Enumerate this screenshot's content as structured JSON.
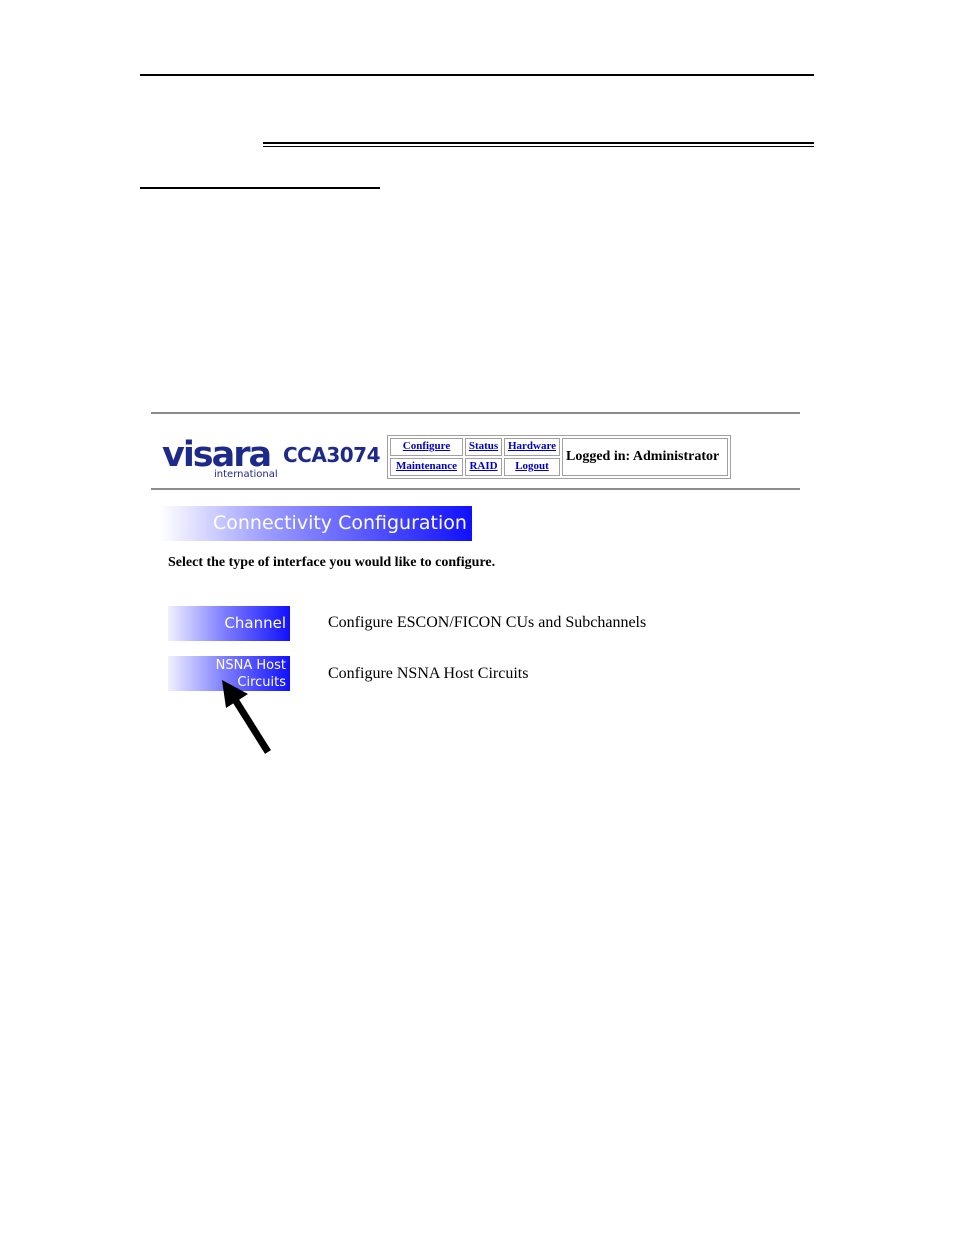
{
  "header": {
    "logo_text": "visara",
    "logo_subtext": "international",
    "product": "CCA3074",
    "nav": {
      "configure": "Configure",
      "status": "Status",
      "hardware": "Hardware",
      "maintenance": "Maintenance",
      "raid": "RAID",
      "logout": "Logout"
    },
    "login_status": "Logged in: Administrator"
  },
  "main": {
    "section_title": "Connectivity Configuration",
    "instruction": "Select the type of interface you would like to configure.",
    "options": [
      {
        "button_label": "Channel",
        "description": "Configure ESCON/FICON CUs and Subchannels"
      },
      {
        "button_label_line1": "NSNA Host",
        "button_label_line2": "Circuits",
        "description": "Configure NSNA Host Circuits"
      }
    ]
  },
  "colors": {
    "link": "#0000cc",
    "accent": "#1010ff",
    "logo_blue": "#1e2a8a"
  },
  "icons": [
    "callout-arrow-icon"
  ]
}
